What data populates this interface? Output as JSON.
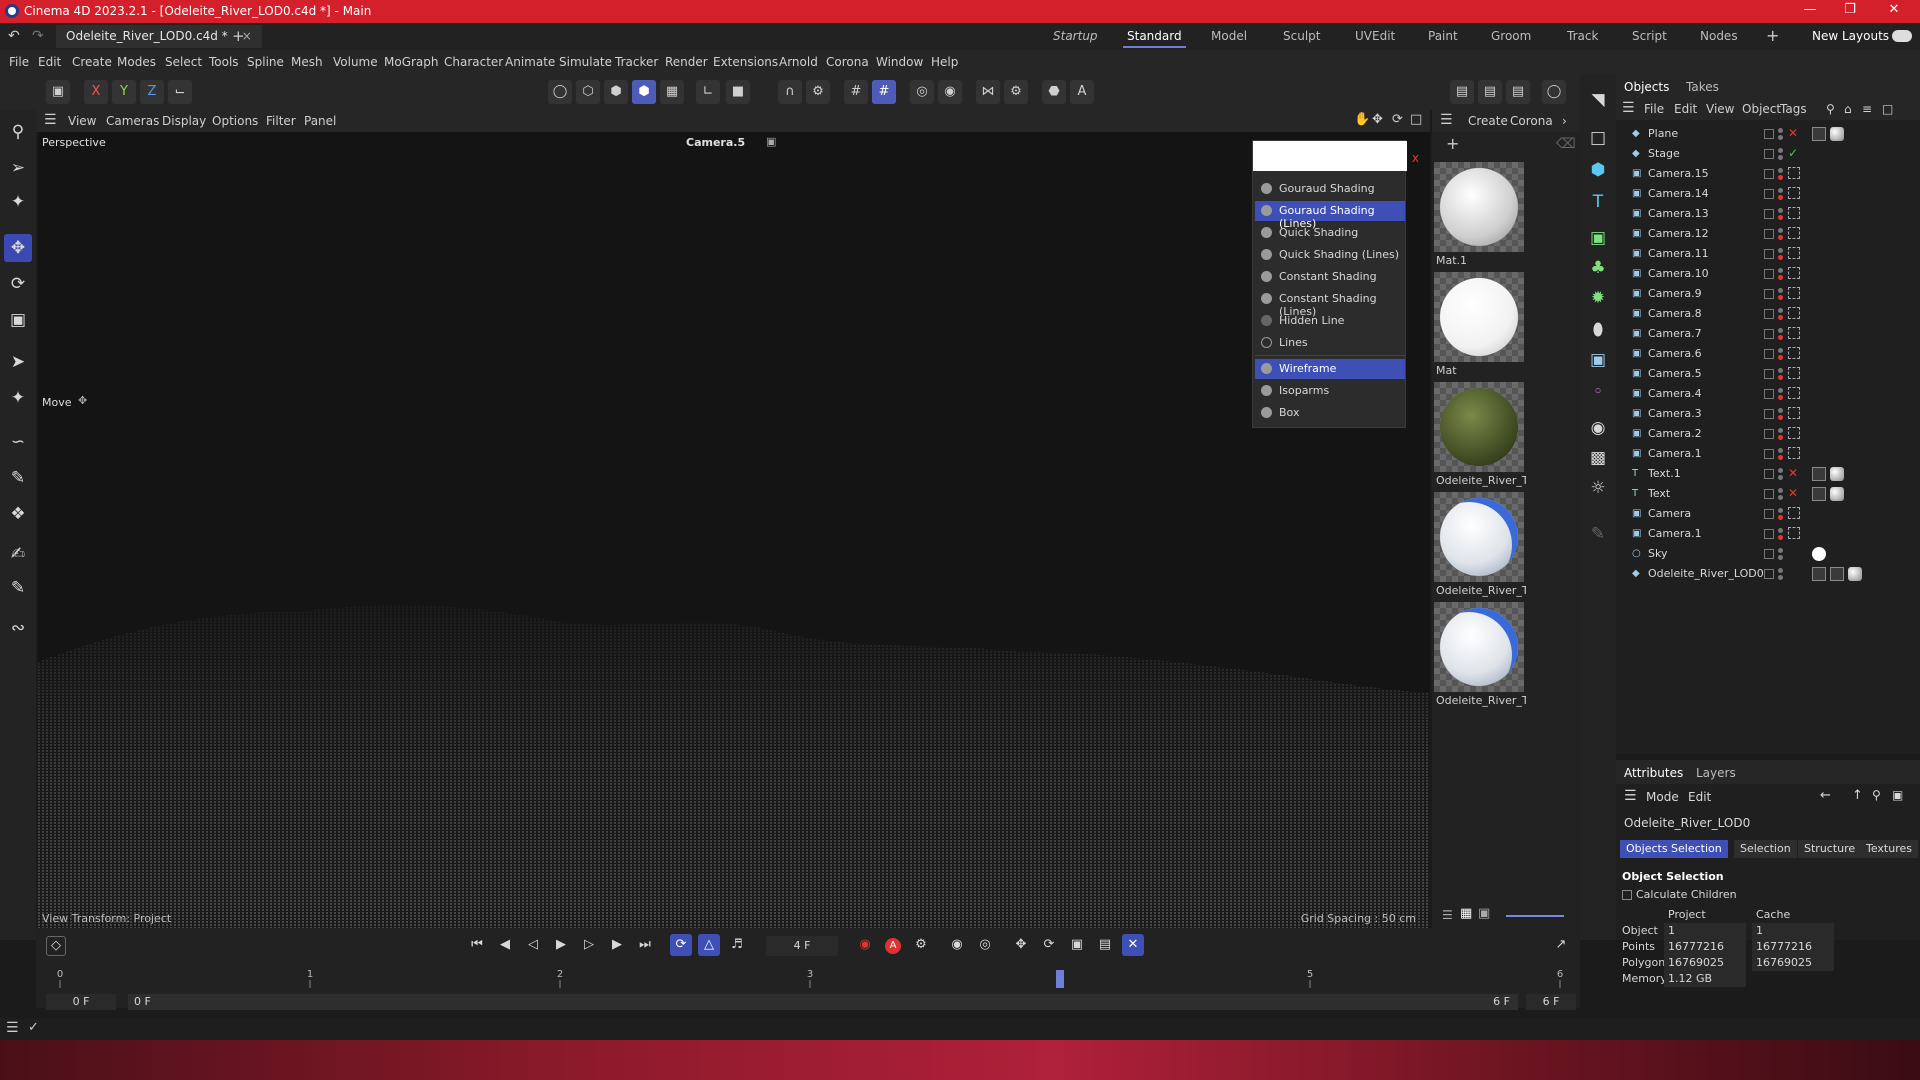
{
  "window": {
    "title": "Cinema 4D 2023.2.1 - [Odeleite_River_LOD0.c4d *] - Main"
  },
  "doc_tab": {
    "label": "Odeleite_River_LOD0.c4d *"
  },
  "layouts": [
    "Startup",
    "Standard",
    "Model",
    "Sculpt",
    "UVEdit",
    "Paint",
    "Groom",
    "Track",
    "Script",
    "Nodes"
  ],
  "new_layouts": "New Layouts",
  "menu": [
    "File",
    "Edit",
    "Create",
    "Modes",
    "Select",
    "Tools",
    "Spline",
    "Mesh",
    "Volume",
    "MoGraph",
    "Character",
    "Animate",
    "Simulate",
    "Tracker",
    "Render",
    "Extensions",
    "Arnold",
    "Corona",
    "Window",
    "Help"
  ],
  "axes": {
    "x": "X",
    "y": "Y",
    "z": "Z"
  },
  "viewport_menu": [
    "View",
    "Cameras",
    "Display",
    "Options",
    "Filter",
    "Panel"
  ],
  "viewport": {
    "name": "Perspective",
    "camera": "Camera.5",
    "tool": "Move",
    "bottom_left": "View Transform: Project",
    "bottom_right": "Grid Spacing : 50 cm"
  },
  "display_menu": {
    "items": [
      "Gouraud Shading",
      "Gouraud Shading (Lines)",
      "Quick Shading",
      "Quick Shading (Lines)",
      "Constant Shading",
      "Constant Shading (Lines)",
      "Hidden Line",
      "Lines"
    ],
    "items2": [
      "Wireframe",
      "Isoparms",
      "Box"
    ],
    "close": "x"
  },
  "material_menu": [
    "Create",
    "Corona"
  ],
  "materials": [
    {
      "name": "Mat.1",
      "color": "#e8e8e8"
    },
    {
      "name": "Mat",
      "color": "#ffffff"
    },
    {
      "name": "Odeleite_River_Te",
      "color": "#4a5a2a"
    },
    {
      "name": "Odeleite_River_Te",
      "color": "#dfe4ea"
    },
    {
      "name": "Odeleite_River_Te",
      "color": "#dfe4ea"
    }
  ],
  "objects_panel": {
    "tabs": [
      "Objects",
      "Takes"
    ],
    "menu": [
      "File",
      "Edit",
      "View",
      "Object",
      "Tags"
    ],
    "rows": [
      "Plane",
      "Stage",
      "Camera.15",
      "Camera.14",
      "Camera.13",
      "Camera.12",
      "Camera.11",
      "Camera.10",
      "Camera.9",
      "Camera.8",
      "Camera.7",
      "Camera.6",
      "Camera.5",
      "Camera.4",
      "Camera.3",
      "Camera.2",
      "Camera.1",
      "Text.1",
      "Text",
      "Camera",
      "Camera.1",
      "Sky",
      "Odeleite_River_LOD0"
    ]
  },
  "attributes": {
    "tabs": [
      "Attributes",
      "Layers"
    ],
    "menu": [
      "Mode",
      "Edit"
    ],
    "object_name": "Odeleite_River_LOD0",
    "buttons": [
      "Objects Selection",
      "Selection",
      "Structure",
      "Textures"
    ],
    "section": "Object Selection",
    "checkbox": "Calculate Children",
    "col_project": "Project",
    "col_cache": "Cache",
    "rows": [
      {
        "label": "Object",
        "project": "1",
        "cache": "1"
      },
      {
        "label": "Points",
        "project": "16777216",
        "cache": "16777216"
      },
      {
        "label": "Polygons",
        "project": "16769025",
        "cache": "16769025"
      },
      {
        "label": "Memory",
        "project": "1.12 GB",
        "cache": ""
      }
    ]
  },
  "timeline": {
    "current_frame": "4 F",
    "start": "0 F",
    "start2": "0 F",
    "end": "6 F",
    "end2": "6 F",
    "ticks": [
      "0",
      "1",
      "2",
      "3",
      "4",
      "5",
      "6"
    ],
    "playhead_frame": 4,
    "total_frames": 6
  },
  "colors": {
    "accent": "#3e4fb5",
    "titlebar": "#d4202b"
  }
}
